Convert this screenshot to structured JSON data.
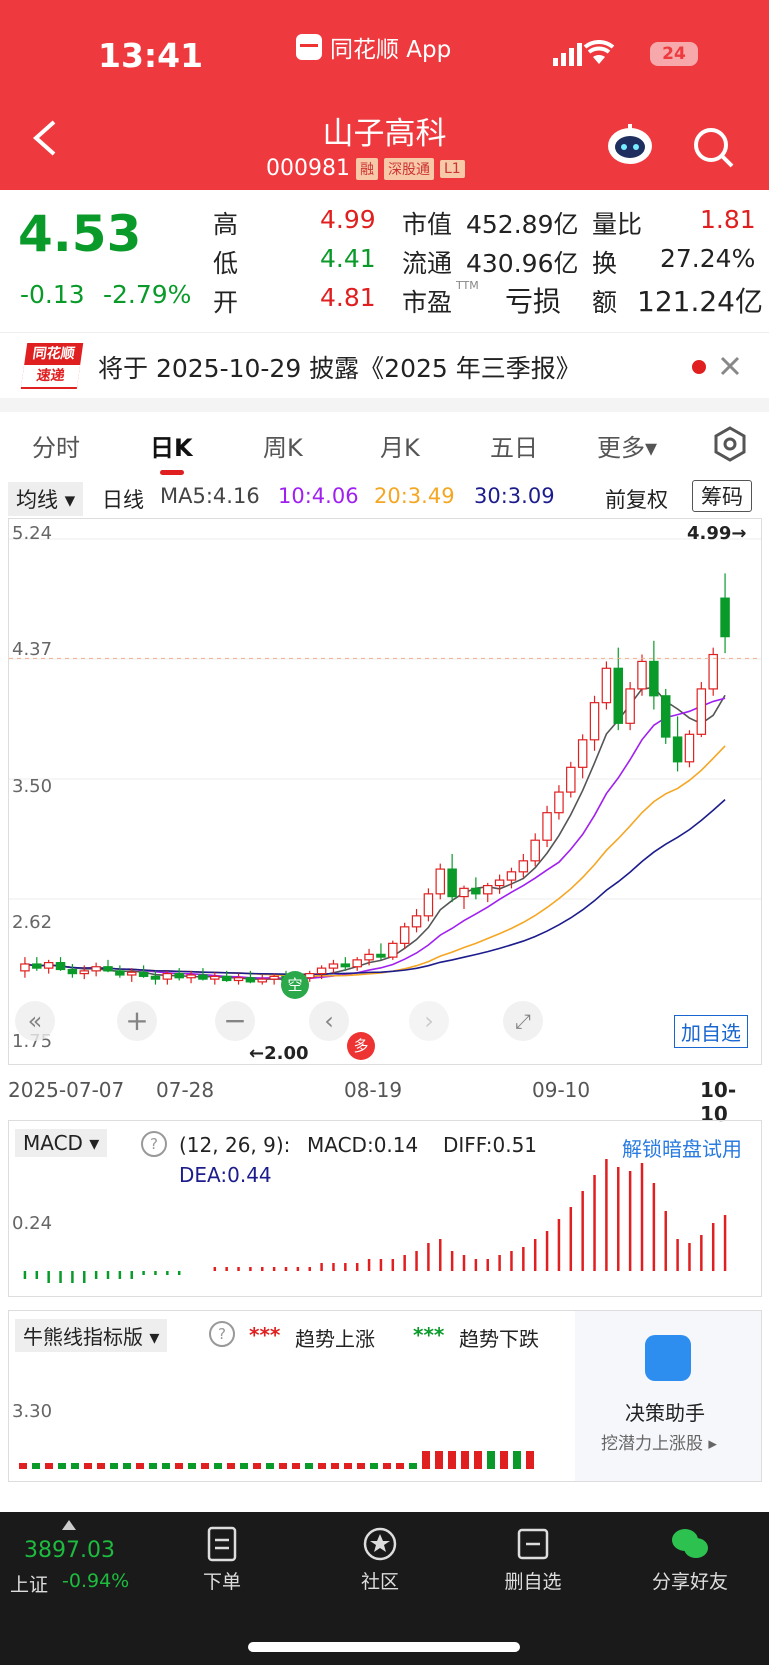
{
  "status_bar": {
    "time": "13:41",
    "app_label": "同花顺 App",
    "battery": "24"
  },
  "header": {
    "title": "山子高科",
    "code": "000981",
    "tags": [
      "融",
      "深股通",
      "L1"
    ]
  },
  "quote": {
    "price": "4.53",
    "change": "-0.13",
    "change_pct": "-2.79%",
    "high_label": "高",
    "high": "4.99",
    "low_label": "低",
    "low": "4.41",
    "open_label": "开",
    "open": "4.81",
    "mcap_label": "市值",
    "mcap": "452.89亿",
    "float_label": "流通",
    "float": "430.96亿",
    "pe_label": "市盈",
    "pe_sup": "TTM",
    "pe": "亏损",
    "vr_label": "量比",
    "vr": "1.81",
    "turn_label": "换",
    "turn": "27.24%",
    "amt_label": "额",
    "amt": "121.24亿"
  },
  "notice": {
    "logo_top": "同花顺",
    "logo_bottom": "速递",
    "text": "将于 2025-10-29 披露《2025 年三季报》"
  },
  "tabs": [
    "分时",
    "日K",
    "周K",
    "月K",
    "五日",
    "更多▾"
  ],
  "ma_line": {
    "mode": "均线",
    "period": "日线",
    "ma5": "MA5:4.16",
    "ma10": "10:4.06",
    "ma20": "20:3.49",
    "ma30": "30:3.09",
    "adjust": "前复权",
    "chips": "筹码"
  },
  "kchart": {
    "y_labels": [
      "5.24",
      "4.37",
      "3.50",
      "2.62",
      "1.75"
    ],
    "high_marker": "4.99→",
    "low_marker": "←2.00",
    "add_watch": "加自选",
    "kong": "空",
    "duo": "多"
  },
  "dates": [
    "2025-07-07",
    "07-28",
    "08-19",
    "09-10",
    "10-10"
  ],
  "macd": {
    "name": "MACD",
    "params": "(12, 26, 9):",
    "macd": "MACD:0.14",
    "diff": "DIFF:0.51",
    "dea": "DEA:0.44",
    "unlock": "解锁暗盘试用",
    "y_label": "0.24"
  },
  "bull": {
    "name": "牛熊线指标版",
    "up_legend": "趋势上涨",
    "down_legend": "趋势下跌",
    "y_label": "3.30",
    "promo_title": "决策助手",
    "promo_sub": "挖潜力上涨股 ▸"
  },
  "bottom": {
    "index_value": "3897.03",
    "index_name": "上证",
    "index_change": "-0.94%",
    "nav": [
      "下单",
      "社区",
      "删自选",
      "分享好友"
    ]
  },
  "chart_data": {
    "type": "candlestick",
    "ylim": [
      1.75,
      5.24
    ],
    "categories_labels": [
      "2025-07-07",
      "07-28",
      "08-19",
      "09-10",
      "10-10"
    ],
    "ohlc": [
      [
        2.1,
        2.2,
        2.05,
        2.15
      ],
      [
        2.15,
        2.2,
        2.1,
        2.12
      ],
      [
        2.12,
        2.18,
        2.08,
        2.16
      ],
      [
        2.16,
        2.2,
        2.1,
        2.11
      ],
      [
        2.11,
        2.15,
        2.05,
        2.08
      ],
      [
        2.08,
        2.14,
        2.04,
        2.1
      ],
      [
        2.1,
        2.16,
        2.06,
        2.13
      ],
      [
        2.13,
        2.18,
        2.09,
        2.1
      ],
      [
        2.1,
        2.14,
        2.05,
        2.07
      ],
      [
        2.07,
        2.12,
        2.02,
        2.09
      ],
      [
        2.09,
        2.14,
        2.05,
        2.06
      ],
      [
        2.06,
        2.1,
        2.0,
        2.04
      ],
      [
        2.04,
        2.1,
        2.0,
        2.08
      ],
      [
        2.08,
        2.12,
        2.03,
        2.05
      ],
      [
        2.05,
        2.1,
        2.01,
        2.07
      ],
      [
        2.07,
        2.12,
        2.03,
        2.04
      ],
      [
        2.04,
        2.09,
        2.0,
        2.06
      ],
      [
        2.06,
        2.1,
        2.02,
        2.03
      ],
      [
        2.03,
        2.08,
        2.0,
        2.05
      ],
      [
        2.05,
        2.1,
        2.01,
        2.02
      ],
      [
        2.02,
        2.07,
        2.0,
        2.04
      ],
      [
        2.04,
        2.08,
        2.0,
        2.06
      ],
      [
        2.06,
        2.1,
        2.02,
        2.03
      ],
      [
        2.03,
        2.08,
        2.0,
        2.05
      ],
      [
        2.05,
        2.1,
        2.02,
        2.08
      ],
      [
        2.08,
        2.14,
        2.04,
        2.12
      ],
      [
        2.12,
        2.18,
        2.08,
        2.15
      ],
      [
        2.15,
        2.2,
        2.1,
        2.13
      ],
      [
        2.13,
        2.2,
        2.1,
        2.18
      ],
      [
        2.18,
        2.26,
        2.14,
        2.22
      ],
      [
        2.22,
        2.3,
        2.18,
        2.2
      ],
      [
        2.2,
        2.32,
        2.18,
        2.3
      ],
      [
        2.3,
        2.45,
        2.26,
        2.42
      ],
      [
        2.42,
        2.55,
        2.38,
        2.5
      ],
      [
        2.5,
        2.7,
        2.46,
        2.66
      ],
      [
        2.66,
        2.88,
        2.62,
        2.84
      ],
      [
        2.84,
        2.95,
        2.6,
        2.64
      ],
      [
        2.64,
        2.72,
        2.55,
        2.7
      ],
      [
        2.7,
        2.78,
        2.62,
        2.66
      ],
      [
        2.66,
        2.74,
        2.6,
        2.72
      ],
      [
        2.72,
        2.8,
        2.66,
        2.76
      ],
      [
        2.76,
        2.85,
        2.7,
        2.82
      ],
      [
        2.82,
        2.95,
        2.78,
        2.9
      ],
      [
        2.9,
        3.1,
        2.86,
        3.05
      ],
      [
        3.05,
        3.3,
        3.0,
        3.25
      ],
      [
        3.25,
        3.45,
        3.2,
        3.4
      ],
      [
        3.4,
        3.62,
        3.36,
        3.58
      ],
      [
        3.58,
        3.82,
        3.5,
        3.78
      ],
      [
        3.78,
        4.1,
        3.7,
        4.05
      ],
      [
        4.05,
        4.35,
        4.0,
        4.3
      ],
      [
        4.3,
        4.45,
        3.85,
        3.9
      ],
      [
        3.9,
        4.2,
        3.85,
        4.15
      ],
      [
        4.15,
        4.4,
        4.1,
        4.35
      ],
      [
        4.35,
        4.5,
        4.0,
        4.1
      ],
      [
        4.1,
        4.15,
        3.75,
        3.8
      ],
      [
        3.8,
        3.95,
        3.55,
        3.62
      ],
      [
        3.62,
        3.85,
        3.58,
        3.82
      ],
      [
        3.82,
        4.2,
        3.8,
        4.15
      ],
      [
        4.15,
        4.45,
        4.1,
        4.4
      ],
      [
        4.81,
        4.99,
        4.41,
        4.53
      ]
    ],
    "ma_series": [
      {
        "name": "MA5",
        "value": "4.16"
      },
      {
        "name": "10",
        "value": "4.06"
      },
      {
        "name": "20",
        "value": "3.49"
      },
      {
        "name": "30",
        "value": "3.09"
      }
    ],
    "macd_hist": [
      -0.02,
      -0.02,
      -0.03,
      -0.03,
      -0.03,
      -0.03,
      -0.02,
      -0.02,
      -0.02,
      -0.02,
      -0.01,
      -0.01,
      -0.01,
      -0.01,
      0.0,
      0.0,
      0.01,
      0.01,
      0.01,
      0.01,
      0.01,
      0.01,
      0.01,
      0.01,
      0.01,
      0.02,
      0.02,
      0.02,
      0.02,
      0.03,
      0.03,
      0.03,
      0.04,
      0.05,
      0.07,
      0.08,
      0.05,
      0.04,
      0.03,
      0.03,
      0.04,
      0.05,
      0.06,
      0.08,
      0.1,
      0.13,
      0.16,
      0.2,
      0.24,
      0.28,
      0.26,
      0.25,
      0.27,
      0.22,
      0.15,
      0.08,
      0.07,
      0.09,
      0.12,
      0.14
    ]
  },
  "colors": {
    "header": "#ee3a3f",
    "up": "#e02020",
    "down": "#0a9a2a",
    "ma5": "#555555",
    "ma10": "#a020f0",
    "ma20": "#f5a623",
    "ma30": "#1c1c8c"
  }
}
